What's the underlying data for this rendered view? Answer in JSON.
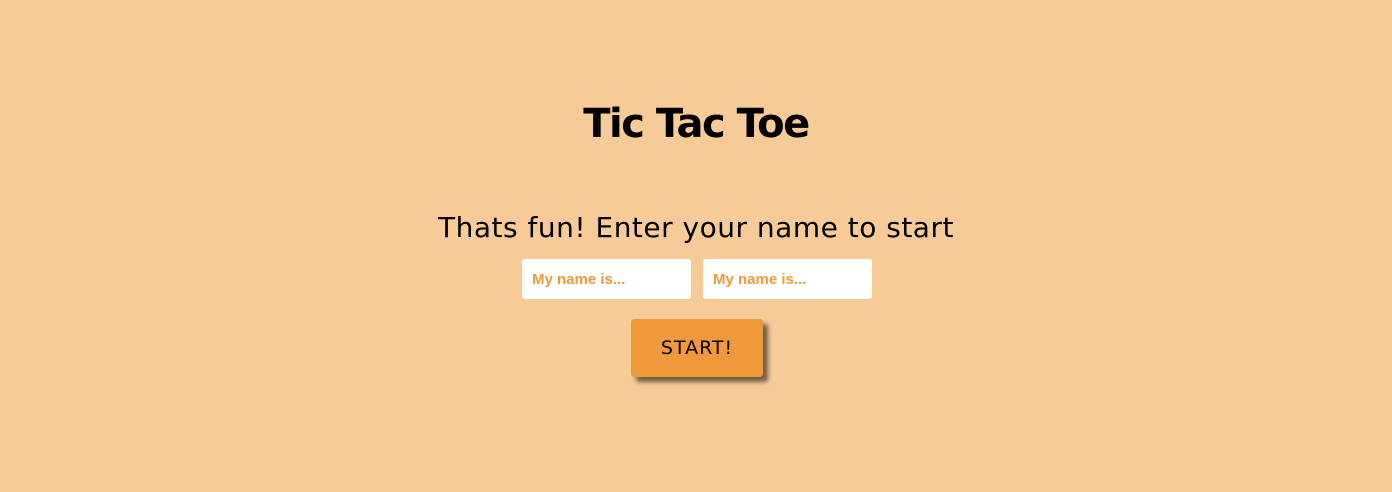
{
  "game": {
    "title": "Tic Tac Toe",
    "subtitle": "Thats fun! Enter your name to start"
  },
  "form": {
    "player1_placeholder": "My name is...",
    "player2_placeholder": "My name is...",
    "player1_value": "",
    "player2_value": "",
    "start_label": "START!"
  },
  "colors": {
    "background": "#f7cb98",
    "accent": "#f0993a",
    "input_background": "#ffffff",
    "text": "#000000"
  }
}
